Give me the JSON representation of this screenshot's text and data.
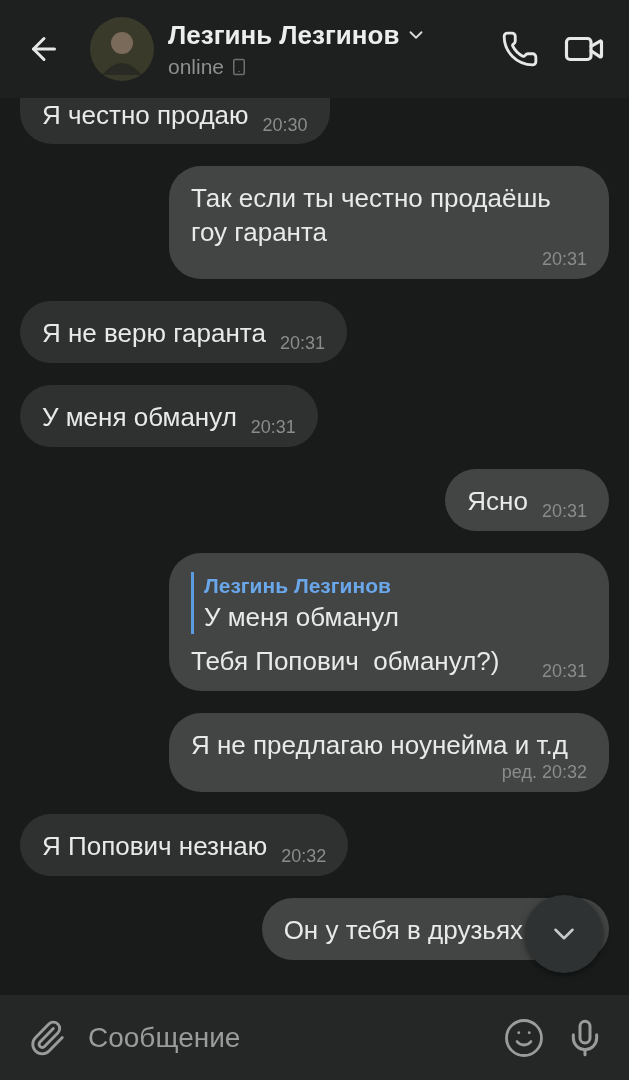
{
  "header": {
    "name": "Лезгинь Лезгинов",
    "status": "online"
  },
  "messages": [
    {
      "kind": "text",
      "outgoing": false,
      "text": "Я честно продаю",
      "time": "20:30"
    },
    {
      "kind": "text",
      "outgoing": true,
      "text": "Так если ты честно продаёшь гоу гаранта",
      "time": "20:31"
    },
    {
      "kind": "text",
      "outgoing": false,
      "text": "Я не верю гаранта",
      "time": "20:31"
    },
    {
      "kind": "text",
      "outgoing": false,
      "text": "У меня обманул",
      "time": "20:31"
    },
    {
      "kind": "text",
      "outgoing": true,
      "text": "Ясно",
      "time": "20:31"
    },
    {
      "kind": "reply",
      "outgoing": true,
      "quote_author": "Лезгинь Лезгинов",
      "quote_text": "У меня обманул",
      "text": "Тебя Попович  обманул?)",
      "time": "20:31"
    },
    {
      "kind": "text",
      "outgoing": true,
      "text": "Я не предлагаю ноунейма и т.д",
      "time": "ред. 20:32"
    },
    {
      "kind": "text",
      "outgoing": false,
      "text": "Я Попович незнаю",
      "time": "20:32"
    },
    {
      "kind": "text",
      "outgoing": true,
      "text": "Он у тебя в друзьях"
    }
  ],
  "composer": {
    "placeholder": "Сообщение"
  }
}
